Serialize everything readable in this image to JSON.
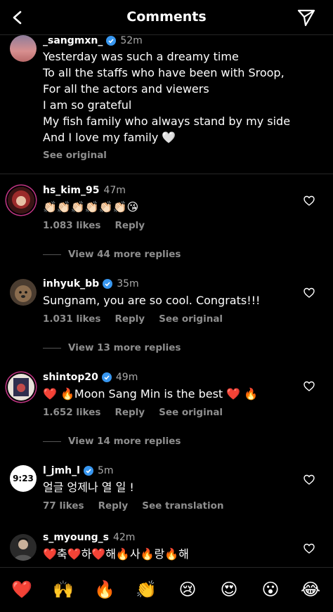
{
  "header": {
    "title": "Comments"
  },
  "caption": {
    "username": "_sangmxn_",
    "time": "52m",
    "lines": [
      "Yesterday was such a dreamy time",
      "To all the staffs who have been with Sroop,",
      "For all the actors and viewers",
      "I am so grateful",
      "My fish family who always stand by my side",
      "And I love my family 🤍"
    ],
    "see_original": "See original"
  },
  "comments": [
    {
      "username": "hs_kim_95",
      "verified": false,
      "time": "47m",
      "text": "👏🏻👏🏻👏🏻👏🏻👏🏻👏🏻😘",
      "likes": "1.083 likes",
      "reply": "Reply",
      "extra": "",
      "replies": "View 44 more replies"
    },
    {
      "username": "inhyuk_bb",
      "verified": true,
      "time": "35m",
      "text": "Sungnam, you are so cool. Congrats!!!",
      "likes": "1.031 likes",
      "reply": "Reply",
      "extra": "See original",
      "replies": "View 13 more replies"
    },
    {
      "username": "shintop20",
      "verified": true,
      "time": "49m",
      "text": "❤️ 🔥Moon Sang Min is the best ❤️ 🔥",
      "likes": "1.652 likes",
      "reply": "Reply",
      "extra": "See original",
      "replies": "View 14 more replies"
    },
    {
      "username": "l_jmh_l",
      "verified": true,
      "time": "5m",
      "text": "얼글 엉제나 열 일 !",
      "likes": "77 likes",
      "reply": "Reply",
      "extra": "See translation",
      "avatar_text": "9:23"
    },
    {
      "username": "s_myoung_s",
      "verified": false,
      "time": "42m",
      "text": "❤️축❤️하❤️해🔥사🔥랑🔥해"
    }
  ],
  "quick_reactions": [
    "❤️",
    "🙌",
    "🔥",
    "👏",
    "😢",
    "😍",
    "😮",
    "😂"
  ],
  "colors": {
    "background": "#000000",
    "secondary_text": "#8e8e8e",
    "verified": "#3897f0"
  }
}
